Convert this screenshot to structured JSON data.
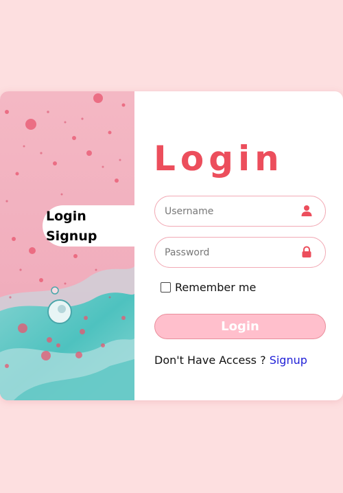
{
  "tabs": {
    "login": "Login",
    "signup": "Signup"
  },
  "form": {
    "title": "Login",
    "username_placeholder": "Username",
    "password_placeholder": "Password",
    "remember_label": "Remember me",
    "submit_label": "Login",
    "access_text": "Don't Have Access ? ",
    "signup_link": "Signup"
  },
  "colors": {
    "background": "#fddfe0",
    "accent": "#ec4e5c",
    "button": "#ffbfcc",
    "link": "#1e1ed7"
  },
  "icons": {
    "username": "user-icon",
    "password": "lock-icon"
  }
}
